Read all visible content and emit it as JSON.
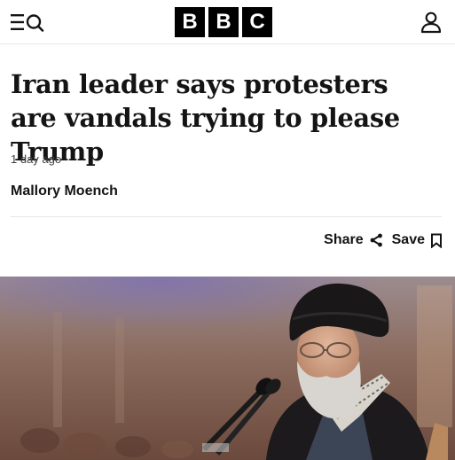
{
  "header": {
    "logo_letters": [
      "B",
      "B",
      "C"
    ],
    "menu_icon": "menu-icon",
    "search_icon": "search-icon",
    "account_icon": "account-icon"
  },
  "article": {
    "headline": "Iran leader says protesters are vandals trying to please Trump",
    "timestamp": "1 day ago",
    "author": "Mallory Moench",
    "share_label": "Share",
    "save_label": "Save",
    "share_icon": "share-icon",
    "save_icon": "bookmark-icon"
  },
  "colors": {
    "text": "#141414",
    "logo_bg": "#000000",
    "logo_text": "#ffffff",
    "divider": "#e6e6e6"
  }
}
